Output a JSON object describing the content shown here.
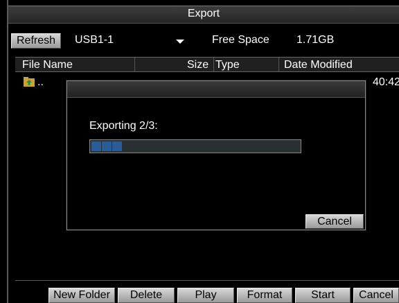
{
  "window": {
    "title": "Export"
  },
  "toolbar_top": {
    "refresh_label": "Refresh",
    "device": "USB1-1",
    "free_space_label": "Free Space",
    "free_space_value": "1.71GB"
  },
  "table": {
    "columns": [
      "File Name",
      "Size",
      "Type",
      "Date Modified"
    ],
    "rows": [
      {
        "name": "..",
        "time_visible": "40:42"
      }
    ]
  },
  "dialog": {
    "message": "Exporting 2/3:",
    "progress_fraction": 0.15,
    "cancel_label": "Cancel"
  },
  "bottom_buttons": [
    "New Folder",
    "Delete",
    "Play",
    "Format",
    "Start",
    "Cancel"
  ],
  "colors": {
    "progress_fill": "#2a5d97",
    "background": "#000000"
  }
}
